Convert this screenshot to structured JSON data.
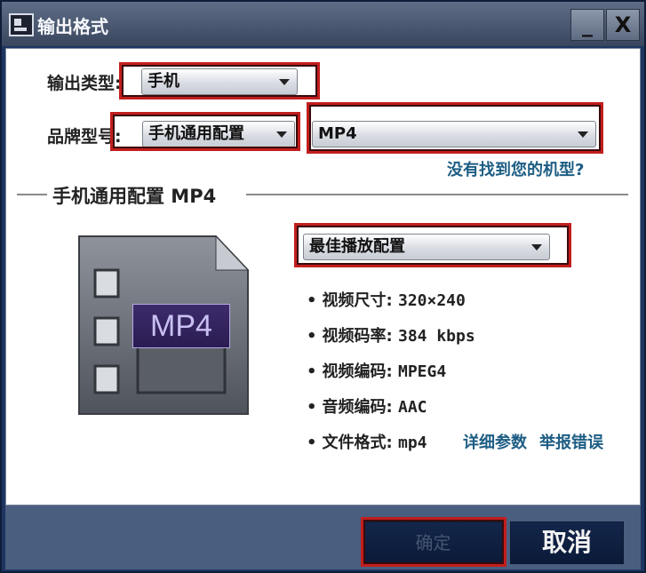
{
  "window": {
    "title": "输出格式",
    "minimize_label": "_",
    "close_label": "X"
  },
  "output_type": {
    "label": "输出类型:",
    "value": "手机"
  },
  "brand_model": {
    "label": "品牌型号:",
    "brand_value": "手机通用配置",
    "model_value": "MP4",
    "not_found_link": "没有找到您的机型?"
  },
  "section": {
    "title": "手机通用配置 MP4"
  },
  "preset": {
    "value": "最佳播放配置"
  },
  "format_icon": {
    "badge_text": "MP4"
  },
  "specs": {
    "bullet": "•",
    "video_size_label": "视频尺寸:",
    "video_size_value": "320×240",
    "video_bitrate_label": "视频码率:",
    "video_bitrate_value": "384 kbps",
    "video_codec_label": "视频编码:",
    "video_codec_value": "MPEG4",
    "audio_codec_label": "音频编码:",
    "audio_codec_value": "AAC",
    "file_format_label": "文件格式:",
    "file_format_value": "mp4",
    "details_link": "详细参数",
    "report_link": "举报错误"
  },
  "buttons": {
    "ok_label": "确定",
    "cancel_label": "取消"
  },
  "colors": {
    "highlight": "#c21e1e",
    "link": "#1d5d84",
    "titlebar": "#4a5870"
  },
  "icons": {
    "app": "app-icon",
    "dropdown": "chevron-down-icon",
    "format": "film-strip-icon"
  }
}
